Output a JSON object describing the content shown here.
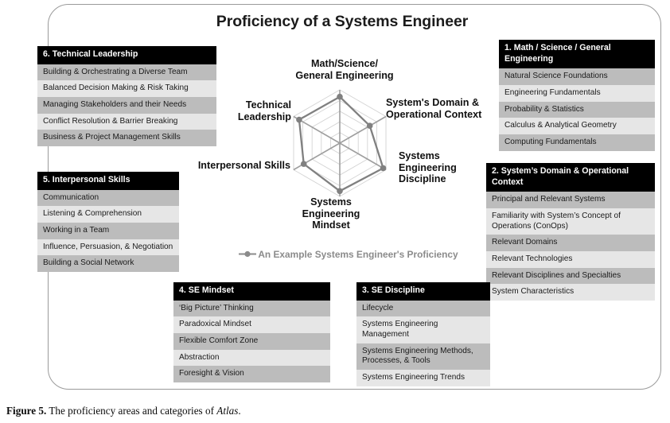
{
  "figure": {
    "title": "Proficiency of a Systems Engineer",
    "caption_lead": "Figure 5.",
    "caption_body": "The proficiency areas and categories of ",
    "caption_italic": "Atlas",
    "caption_end": "."
  },
  "panels": {
    "p6": {
      "heading": "6. Technical Leadership",
      "items": [
        "Building & Orchestrating a Diverse Team",
        "Balanced Decision Making & Risk Taking",
        "Managing Stakeholders and their Needs",
        "Conflict Resolution & Barrier Breaking",
        "Business & Project Management Skills"
      ]
    },
    "p1": {
      "heading": "1. Math / Science / General Engineering",
      "items": [
        "Natural Science Foundations",
        "Engineering Fundamentals",
        "Probability & Statistics",
        "Calculus & Analytical Geometry",
        "Computing Fundamentals"
      ]
    },
    "p2": {
      "heading": "2. System’s Domain & Operational Context",
      "items": [
        "Principal and Relevant Systems",
        "Familiarity with System’s Concept of Operations (ConOps)",
        "Relevant Domains",
        "Relevant Technologies",
        "Relevant Disciplines and Specialties",
        "System Characteristics"
      ]
    },
    "p5": {
      "heading": "5. Interpersonal Skills",
      "items": [
        "Communication",
        "Listening & Comprehension",
        "Working in a Team",
        "Influence, Persuasion, & Negotiation",
        "Building a Social Network"
      ]
    },
    "p4": {
      "heading": "4. SE Mindset",
      "items": [
        "‘Big Picture’ Thinking",
        "Paradoxical Mindset",
        "Flexible Comfort Zone",
        "Abstraction",
        "Foresight & Vision"
      ]
    },
    "p3": {
      "heading": "3. SE Discipline",
      "items": [
        "Lifecycle",
        "Systems Engineering Management",
        "Systems Engineering Methods, Processes, & Tools",
        "Systems Engineering Trends"
      ]
    }
  },
  "radar_labels": {
    "math": "Math/Science/\nGeneral Engineering",
    "domain": "System's Domain &\nOperational Context",
    "discipline": "Systems\nEngineering\nDiscipline",
    "mindset": "Systems\nEngineering\nMindset",
    "interpersonal": "Interpersonal Skills",
    "techlead": "Technical\nLeadership"
  },
  "chart_data": {
    "type": "radar",
    "title": "Proficiency of a Systems Engineer",
    "categories": [
      "Math/Science/General Engineering",
      "System's Domain & Operational Context",
      "Systems Engineering Discipline",
      "Systems Engineering Mindset",
      "Interpersonal Skills",
      "Technical Leadership"
    ],
    "series": [
      {
        "name": "An Example Systems Engineer's Proficiency",
        "values": [
          4.35,
          3.25,
          4.7,
          4.5,
          3.9,
          4.4
        ],
        "color": "#808080"
      }
    ],
    "rmax": 5,
    "rings": 5,
    "grid": true,
    "grid_color": "#d4d4d4",
    "legend_position": "bottom",
    "legend_label": "An Example Systems Engineer's Proficiency",
    "tick_labels_shown": false
  },
  "colors": {
    "header_bg": "#000000",
    "header_text": "#ffffff",
    "row_dark": "#bcbcbc",
    "row_light": "#e6e6e6",
    "series": "#808080",
    "frame_border": "#9a9a9a"
  }
}
